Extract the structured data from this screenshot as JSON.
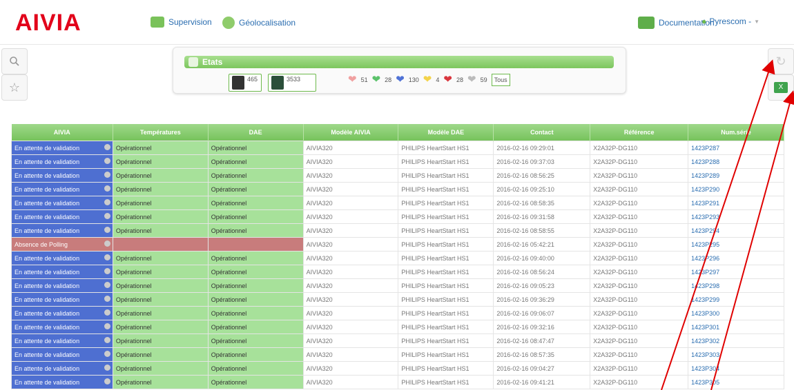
{
  "logo": "AIVIA",
  "nav": {
    "supervision": "Supervision",
    "geo": "Géolocalisation",
    "documentation": "Documentation",
    "user": "Pyrescom -"
  },
  "etats": {
    "title": "Etats",
    "counters": [
      "465",
      "3533"
    ],
    "hearts": [
      {
        "value": "51",
        "color": "#f0a0a0"
      },
      {
        "value": "28",
        "color": "#5cc26b"
      },
      {
        "value": "130",
        "color": "#4f72d6"
      },
      {
        "value": "4",
        "color": "#f3d34a"
      },
      {
        "value": "28",
        "color": "#d9363e"
      },
      {
        "value": "59",
        "color": "#bbbbbb"
      }
    ],
    "all": "Tous"
  },
  "table": {
    "headers": [
      "AIVIA",
      "Températures",
      "DAE",
      "Modèle AIVIA",
      "Modèle DAE",
      "Contact",
      "Référence",
      "Num.série"
    ],
    "rows": [
      {
        "aivia": "En attente de validation",
        "temp": "Opérationnel",
        "dae": "Opérationnel",
        "modele": "AIVIA320",
        "dae_model": "PHILIPS HeartStart HS1",
        "contact": "2016-02-16 09:29:01",
        "ref": "X2A32P-DG110",
        "serial": "1423P287",
        "alarm": false
      },
      {
        "aivia": "En attente de validation",
        "temp": "Opérationnel",
        "dae": "Opérationnel",
        "modele": "AIVIA320",
        "dae_model": "PHILIPS HeartStart HS1",
        "contact": "2016-02-16 09:37:03",
        "ref": "X2A32P-DG110",
        "serial": "1423P288",
        "alarm": false
      },
      {
        "aivia": "En attente de validation",
        "temp": "Opérationnel",
        "dae": "Opérationnel",
        "modele": "AIVIA320",
        "dae_model": "PHILIPS HeartStart HS1",
        "contact": "2016-02-16 08:56:25",
        "ref": "X2A32P-DG110",
        "serial": "1423P289",
        "alarm": false
      },
      {
        "aivia": "En attente de validation",
        "temp": "Opérationnel",
        "dae": "Opérationnel",
        "modele": "AIVIA320",
        "dae_model": "PHILIPS HeartStart HS1",
        "contact": "2016-02-16 09:25:10",
        "ref": "X2A32P-DG110",
        "serial": "1423P290",
        "alarm": false
      },
      {
        "aivia": "En attente de validation",
        "temp": "Opérationnel",
        "dae": "Opérationnel",
        "modele": "AIVIA320",
        "dae_model": "PHILIPS HeartStart HS1",
        "contact": "2016-02-16 08:58:35",
        "ref": "X2A32P-DG110",
        "serial": "1423P291",
        "alarm": false
      },
      {
        "aivia": "En attente de validation",
        "temp": "Opérationnel",
        "dae": "Opérationnel",
        "modele": "AIVIA320",
        "dae_model": "PHILIPS HeartStart HS1",
        "contact": "2016-02-16 09:31:58",
        "ref": "X2A32P-DG110",
        "serial": "1423P293",
        "alarm": false
      },
      {
        "aivia": "En attente de validation",
        "temp": "Opérationnel",
        "dae": "Opérationnel",
        "modele": "AIVIA320",
        "dae_model": "PHILIPS HeartStart HS1",
        "contact": "2016-02-16 08:58:55",
        "ref": "X2A32P-DG110",
        "serial": "1423P294",
        "alarm": false
      },
      {
        "aivia": "Absence de Polling",
        "temp": "",
        "dae": "",
        "modele": "AIVIA320",
        "dae_model": "PHILIPS HeartStart HS1",
        "contact": "2016-02-16 05:42:21",
        "ref": "X2A32P-DG110",
        "serial": "1423P295",
        "alarm": true
      },
      {
        "aivia": "En attente de validation",
        "temp": "Opérationnel",
        "dae": "Opérationnel",
        "modele": "AIVIA320",
        "dae_model": "PHILIPS HeartStart HS1",
        "contact": "2016-02-16 09:40:00",
        "ref": "X2A32P-DG110",
        "serial": "1423P296",
        "alarm": false
      },
      {
        "aivia": "En attente de validation",
        "temp": "Opérationnel",
        "dae": "Opérationnel",
        "modele": "AIVIA320",
        "dae_model": "PHILIPS HeartStart HS1",
        "contact": "2016-02-16 08:56:24",
        "ref": "X2A32P-DG110",
        "serial": "1423P297",
        "alarm": false
      },
      {
        "aivia": "En attente de validation",
        "temp": "Opérationnel",
        "dae": "Opérationnel",
        "modele": "AIVIA320",
        "dae_model": "PHILIPS HeartStart HS1",
        "contact": "2016-02-16 09:05:23",
        "ref": "X2A32P-DG110",
        "serial": "1423P298",
        "alarm": false
      },
      {
        "aivia": "En attente de validation",
        "temp": "Opérationnel",
        "dae": "Opérationnel",
        "modele": "AIVIA320",
        "dae_model": "PHILIPS HeartStart HS1",
        "contact": "2016-02-16 09:36:29",
        "ref": "X2A32P-DG110",
        "serial": "1423P299",
        "alarm": false
      },
      {
        "aivia": "En attente de validation",
        "temp": "Opérationnel",
        "dae": "Opérationnel",
        "modele": "AIVIA320",
        "dae_model": "PHILIPS HeartStart HS1",
        "contact": "2016-02-16 09:06:07",
        "ref": "X2A32P-DG110",
        "serial": "1423P300",
        "alarm": false
      },
      {
        "aivia": "En attente de validation",
        "temp": "Opérationnel",
        "dae": "Opérationnel",
        "modele": "AIVIA320",
        "dae_model": "PHILIPS HeartStart HS1",
        "contact": "2016-02-16 09:32:16",
        "ref": "X2A32P-DG110",
        "serial": "1423P301",
        "alarm": false
      },
      {
        "aivia": "En attente de validation",
        "temp": "Opérationnel",
        "dae": "Opérationnel",
        "modele": "AIVIA320",
        "dae_model": "PHILIPS HeartStart HS1",
        "contact": "2016-02-16 08:47:47",
        "ref": "X2A32P-DG110",
        "serial": "1423P302",
        "alarm": false
      },
      {
        "aivia": "En attente de validation",
        "temp": "Opérationnel",
        "dae": "Opérationnel",
        "modele": "AIVIA320",
        "dae_model": "PHILIPS HeartStart HS1",
        "contact": "2016-02-16 08:57:35",
        "ref": "X2A32P-DG110",
        "serial": "1423P303",
        "alarm": false
      },
      {
        "aivia": "En attente de validation",
        "temp": "Opérationnel",
        "dae": "Opérationnel",
        "modele": "AIVIA320",
        "dae_model": "PHILIPS HeartStart HS1",
        "contact": "2016-02-16 09:04:27",
        "ref": "X2A32P-DG110",
        "serial": "1423P304",
        "alarm": false
      },
      {
        "aivia": "En attente de validation",
        "temp": "Opérationnel",
        "dae": "Opérationnel",
        "modele": "AIVIA320",
        "dae_model": "PHILIPS HeartStart HS1",
        "contact": "2016-02-16 09:41:21",
        "ref": "X2A32P-DG110",
        "serial": "1423P305",
        "alarm": false
      }
    ]
  },
  "icons": {
    "search": "search-icon",
    "star": "star-icon",
    "refresh": "refresh-icon",
    "excel": "excel-icon",
    "annotation_color": "#e00000"
  }
}
